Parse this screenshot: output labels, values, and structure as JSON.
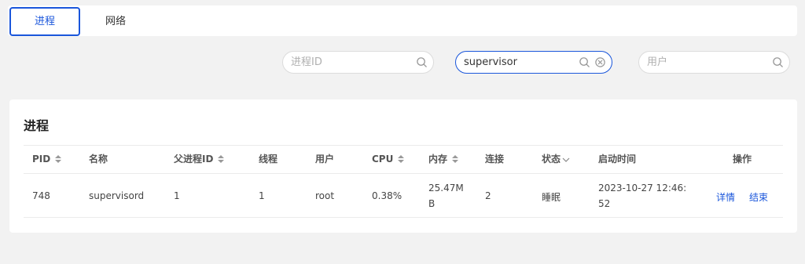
{
  "tabs": [
    {
      "label": "进程",
      "active": true
    },
    {
      "label": "网络",
      "active": false
    }
  ],
  "filters": {
    "pid": {
      "placeholder": "进程ID",
      "value": ""
    },
    "name": {
      "placeholder": "",
      "value": "supervisor"
    },
    "user": {
      "placeholder": "用户",
      "value": ""
    }
  },
  "section": {
    "title": "进程"
  },
  "table": {
    "columns": [
      {
        "label": "PID",
        "sortable": true
      },
      {
        "label": "名称",
        "sortable": false
      },
      {
        "label": "父进程ID",
        "sortable": true
      },
      {
        "label": "线程",
        "sortable": false
      },
      {
        "label": "用户",
        "sortable": false
      },
      {
        "label": "CPU",
        "sortable": true
      },
      {
        "label": "内存",
        "sortable": true
      },
      {
        "label": "连接",
        "sortable": false
      },
      {
        "label": "状态",
        "filter": true
      },
      {
        "label": "启动时间",
        "sortable": false
      },
      {
        "label": "操作",
        "sortable": false
      }
    ],
    "rows": [
      {
        "pid": "748",
        "name": "supervisord",
        "ppid": "1",
        "threads": "1",
        "user": "root",
        "cpu": "0.38%",
        "mem_line1": "25.47M",
        "mem_line2": "B",
        "connections": "2",
        "status": "睡眠",
        "start_line1": "2023-10-27 12:46:",
        "start_line2": "52",
        "action_detail": "详情",
        "action_end": "结束"
      }
    ]
  },
  "colors": {
    "accent": "#1a56db"
  }
}
